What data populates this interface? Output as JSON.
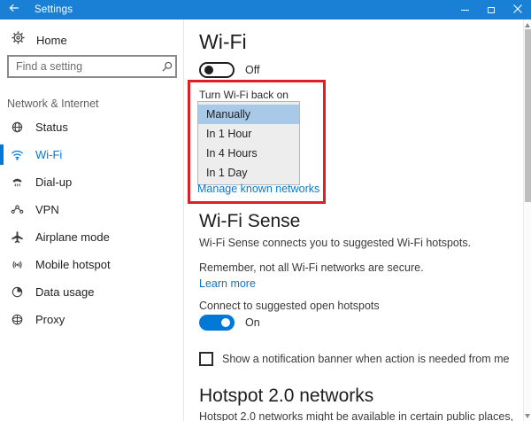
{
  "window": {
    "title": "Settings"
  },
  "sidebar": {
    "home_label": "Home",
    "search_placeholder": "Find a setting",
    "section_label": "Network & Internet",
    "items": [
      {
        "label": "Status",
        "icon": "status-globe-icon"
      },
      {
        "label": "Wi-Fi",
        "icon": "wifi-icon",
        "selected": true
      },
      {
        "label": "Dial-up",
        "icon": "dialup-phone-icon"
      },
      {
        "label": "VPN",
        "icon": "vpn-icon"
      },
      {
        "label": "Airplane mode",
        "icon": "airplane-icon"
      },
      {
        "label": "Mobile hotspot",
        "icon": "mobile-hotspot-icon"
      },
      {
        "label": "Data usage",
        "icon": "data-usage-pie-icon"
      },
      {
        "label": "Proxy",
        "icon": "proxy-globe-icon"
      }
    ]
  },
  "main": {
    "page_title": "Wi-Fi",
    "wifi_toggle": {
      "state": "Off"
    },
    "turn_back_on": {
      "label": "Turn Wi-Fi back on",
      "options": [
        "Manually",
        "In 1 Hour",
        "In 4 Hours",
        "In 1 Day"
      ],
      "selected_option": "Manually"
    },
    "manage_link": "Manage known networks",
    "wifi_sense": {
      "title": "Wi-Fi Sense",
      "line1": "Wi-Fi Sense connects you to suggested Wi-Fi hotspots.",
      "line2": "Remember, not all Wi-Fi networks are secure.",
      "learn_more": "Learn more",
      "connect_label": "Connect to suggested open hotspots",
      "connect_toggle_state": "On",
      "notification_checkbox_label": "Show a notification banner when action is needed from me",
      "notification_checkbox_checked": false
    },
    "hotspot2": {
      "title": "Hotspot 2.0 networks",
      "line1": "Hotspot 2.0 networks might be available in certain public places,"
    }
  },
  "colors": {
    "titlebar": "#1a80d6",
    "accent": "#0078d7",
    "annotation_red": "#dc2026",
    "selected_option_bg": "#a9c9e9",
    "link": "#0a77c9"
  }
}
